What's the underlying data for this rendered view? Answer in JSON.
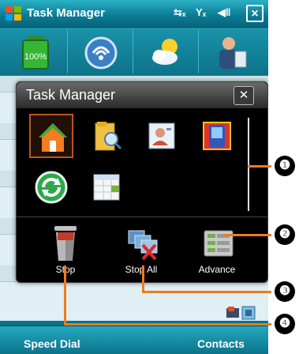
{
  "app": {
    "title": "Task Manager",
    "softkeys": {
      "left": "Speed Dial",
      "right": "Contacts"
    },
    "battery_label": "100%"
  },
  "dialog": {
    "title": "Task Manager",
    "close_label": "✕",
    "apps": [
      {
        "name": "today-home",
        "icon": "home-icon"
      },
      {
        "name": "file-explorer",
        "icon": "folder-search-icon"
      },
      {
        "name": "contacts",
        "icon": "contact-card-icon"
      },
      {
        "name": "app-4",
        "icon": "pda-icon"
      },
      {
        "name": "activesync",
        "icon": "sync-icon"
      },
      {
        "name": "calendar",
        "icon": "calendar-icon"
      }
    ],
    "actions": [
      {
        "label": "Stop"
      },
      {
        "label": "Stop All"
      },
      {
        "label": "Advance"
      }
    ]
  },
  "callouts": [
    "❶",
    "❷",
    "❸",
    "❹"
  ],
  "colors": {
    "accent": "#f07a1e",
    "titlebar": "#0a7a93",
    "dialog_bg": "#000000"
  }
}
